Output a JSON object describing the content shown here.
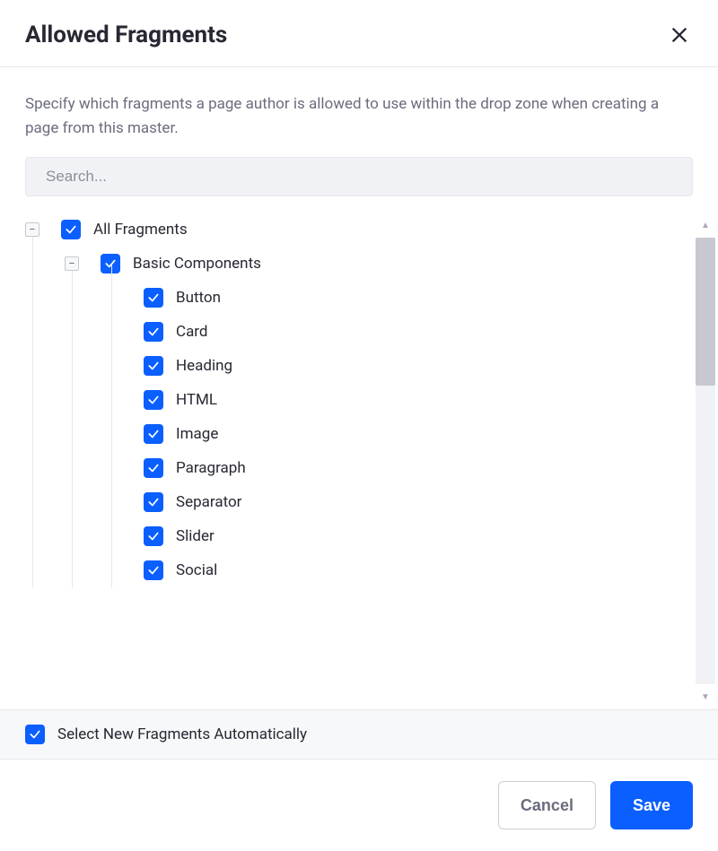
{
  "header": {
    "title": "Allowed Fragments"
  },
  "description": "Specify which fragments a page author is allowed to use within the drop zone when creating a page from this master.",
  "search": {
    "placeholder": "Search..."
  },
  "tree": {
    "root": {
      "label": "All Fragments",
      "checked": true
    },
    "group": {
      "label": "Basic Components",
      "checked": true
    },
    "items": [
      {
        "label": "Button",
        "checked": true
      },
      {
        "label": "Card",
        "checked": true
      },
      {
        "label": "Heading",
        "checked": true
      },
      {
        "label": "HTML",
        "checked": true
      },
      {
        "label": "Image",
        "checked": true
      },
      {
        "label": "Paragraph",
        "checked": true
      },
      {
        "label": "Separator",
        "checked": true
      },
      {
        "label": "Slider",
        "checked": true
      },
      {
        "label": "Social",
        "checked": true
      }
    ]
  },
  "autoSelect": {
    "label": "Select New Fragments Automatically",
    "checked": true
  },
  "footer": {
    "cancel": "Cancel",
    "save": "Save"
  },
  "colors": {
    "accent": "#0b5fff"
  }
}
